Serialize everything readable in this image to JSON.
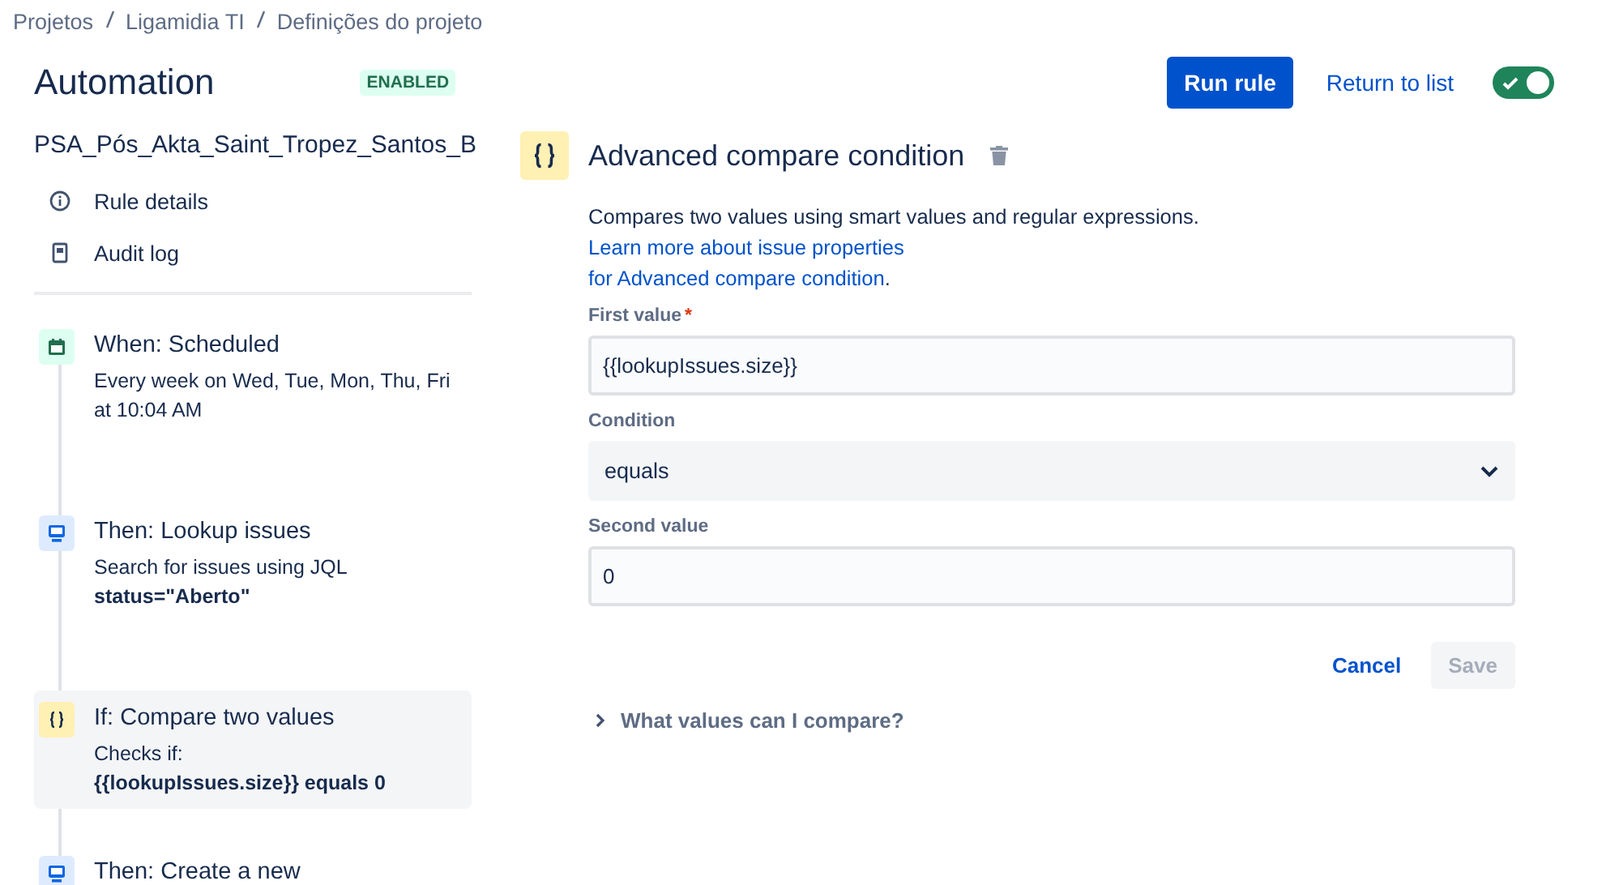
{
  "breadcrumbs": [
    "Projetos",
    "Ligamidia TI",
    "Definições do projeto"
  ],
  "header": {
    "title": "Automation",
    "status": "ENABLED",
    "run_button": "Run rule",
    "return_link": "Return to list",
    "toggle": {
      "on": true
    }
  },
  "rule": {
    "name": "PSA_Pós_Akta_Saint_Tropez_Santos_B",
    "links": [
      {
        "kind": "info",
        "label": "Rule details"
      },
      {
        "kind": "log",
        "label": "Audit log"
      }
    ]
  },
  "steps": [
    {
      "kind": "trigger",
      "title": "When: Scheduled",
      "selected": false,
      "lines": [
        {
          "text": "Every week on Wed, Tue, Mon, Thu, Fri at 10:04 AM",
          "bold": false
        }
      ]
    },
    {
      "kind": "action",
      "title": "Then: Lookup issues",
      "selected": false,
      "lines": [
        {
          "text": "Search for issues using JQL",
          "bold": false
        },
        {
          "text": "status=\"Aberto\"",
          "bold": true
        }
      ]
    },
    {
      "kind": "condition",
      "title": "If: Compare two values",
      "selected": true,
      "lines": [
        {
          "text": "Checks if:",
          "bold": false
        },
        {
          "text": "{{lookupIssues.size}} equals 0",
          "bold": true
        }
      ]
    },
    {
      "kind": "action",
      "title": "Then: Create a new",
      "selected": false
    }
  ],
  "panel": {
    "title": "Advanced compare condition",
    "description": "Compares two values using smart values and regular expressions.",
    "learn_link": [
      "Learn more about issue properties",
      "for Advanced compare condition"
    ],
    "link_end": ".",
    "fields": [
      {
        "kind": "text",
        "label": "First value",
        "required_mark": "*",
        "value": "{{lookupIssues.size}}"
      },
      {
        "kind": "select",
        "label": "Condition",
        "value": "equals"
      },
      {
        "kind": "text",
        "label": "Second value",
        "value": "0"
      }
    ],
    "cancel": "Cancel",
    "save": {
      "label": "Save",
      "disabled": true
    },
    "help": {
      "label": "What values can I compare?",
      "expanded": false
    }
  }
}
